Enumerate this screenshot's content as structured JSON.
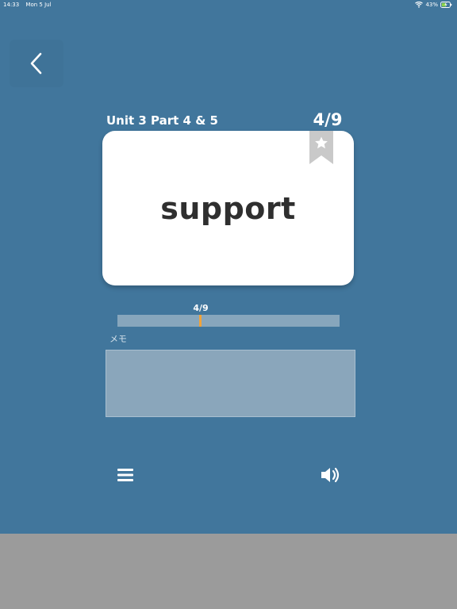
{
  "status_bar": {
    "time": "14:33",
    "date": "Mon 5 Jul",
    "battery_percent": "43%",
    "icons": [
      "wifi-icon",
      "battery-charging-icon"
    ]
  },
  "header": {
    "back_icon": "chevron-left-icon",
    "unit_title": "Unit 3 Part 4 & 5",
    "card_count": "4/9"
  },
  "card": {
    "word": "support",
    "bookmark_icon": "star-bookmark-icon"
  },
  "progress": {
    "label": "4/9",
    "current": 4,
    "total": 9
  },
  "memo": {
    "label": "メモ",
    "value": ""
  },
  "toolbar": {
    "menu_icon": "menu-icon",
    "sound_icon": "speaker-icon"
  },
  "colors": {
    "background": "#41769c",
    "card": "#ffffff",
    "progress_track": "#87a6bc",
    "progress_marker": "#f1a33a",
    "lower_area": "#9b9b9b"
  }
}
